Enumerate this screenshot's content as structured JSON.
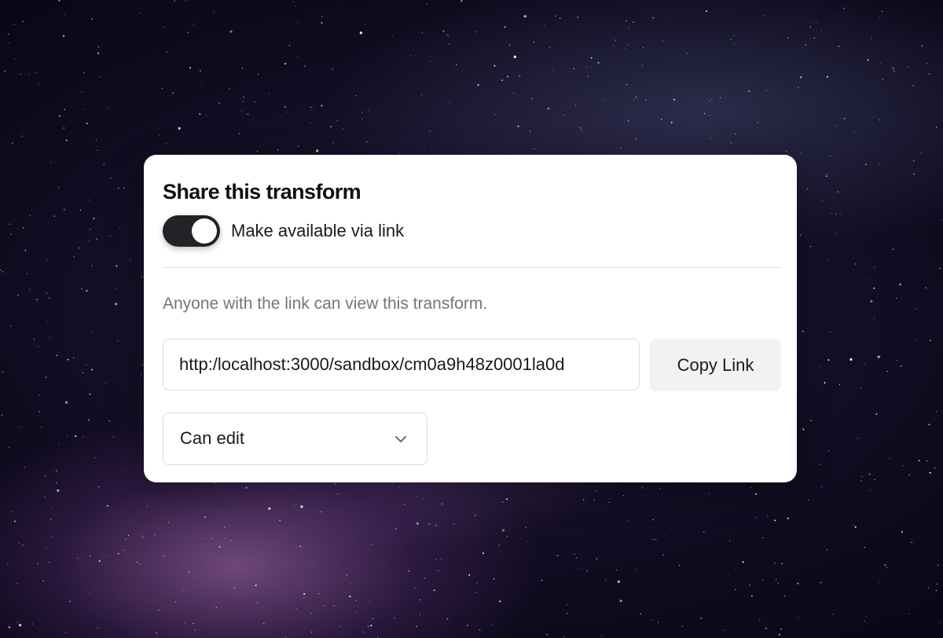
{
  "dialog": {
    "title": "Share this transform",
    "toggle": {
      "label": "Make available via link",
      "on": true
    },
    "hint": "Anyone with the link can view this transform.",
    "link": {
      "value": "http:/localhost:3000/sandbox/cm0a9h48z0001la0d"
    },
    "copy_button": "Copy Link",
    "permission": {
      "selected": "Can edit",
      "icon": "chevron-down-icon"
    }
  },
  "colors": {
    "toggle_on": "#232327",
    "hint_text": "#75757d",
    "copy_button_bg": "#f2f2f4",
    "border": "#dcdce2"
  }
}
